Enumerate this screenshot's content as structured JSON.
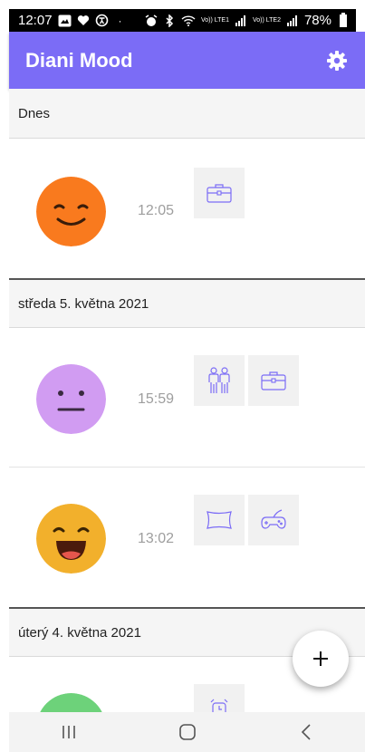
{
  "status_bar": {
    "time": "12:07",
    "signal_text_1": "Vo)) LTE1",
    "signal_text_2": "Vo)) LTE2",
    "battery": "78%"
  },
  "app_bar": {
    "title": "Diani Mood",
    "settings_icon": "gear-icon"
  },
  "days": [
    {
      "header": "Dnes",
      "entries": [
        {
          "mood": "happy",
          "face_color": "#f97a1e",
          "time": "12:05",
          "activities": [
            "briefcase-icon"
          ]
        }
      ]
    },
    {
      "header": "středa 5. května 2021",
      "entries": [
        {
          "mood": "neutral",
          "face_color": "#d19cf2",
          "time": "15:59",
          "activities": [
            "people-icon",
            "briefcase-icon"
          ]
        },
        {
          "mood": "very-happy",
          "face_color": "#f2b02c",
          "time": "13:02",
          "activities": [
            "pillow-icon",
            "gamepad-icon"
          ]
        }
      ]
    },
    {
      "header": "úterý 4. května 2021",
      "entries": [
        {
          "mood": "great",
          "face_color": "#6dd27a",
          "time": "",
          "activities": [
            "alarm-clock-icon"
          ]
        }
      ]
    }
  ],
  "fab": {
    "label": "+"
  },
  "nav_bar": {
    "recents_icon": "recents-icon",
    "home_icon": "home-icon",
    "back_icon": "back-icon"
  },
  "colors": {
    "app_bar": "#7b6cf6",
    "activity_icon": "#7b6cf6",
    "header_bg": "#f5f5f5"
  }
}
